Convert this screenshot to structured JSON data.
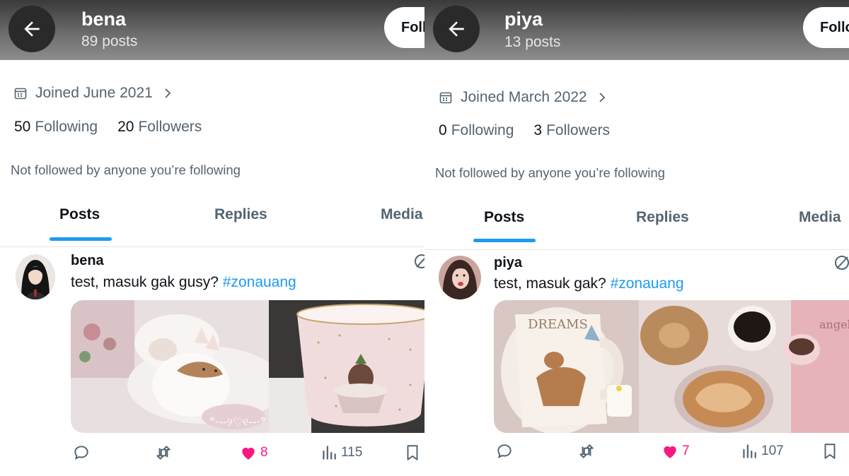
{
  "panels": [
    {
      "header": {
        "name": "bena",
        "posts": "89 posts",
        "follow_label": "Foll"
      },
      "joined": "Joined June 2021",
      "stats": {
        "following_count": "50",
        "following_label": "Following",
        "followers_count": "20",
        "followers_label": "Followers"
      },
      "not_followed": "Not followed by anyone you’re following",
      "tabs": [
        "Posts",
        "Replies",
        "Media"
      ],
      "post": {
        "author": "bena",
        "text": "test, masuk gak gusy? ",
        "hashtag": "#zonauang",
        "likes": "8",
        "views": "115"
      }
    },
    {
      "header": {
        "name": "piya",
        "posts": "13 posts",
        "follow_label": "Follo"
      },
      "joined": "Joined March 2022",
      "stats": {
        "following_count": "0",
        "following_label": "Following",
        "followers_count": "3",
        "followers_label": "Followers"
      },
      "not_followed": "Not followed by anyone you’re following",
      "tabs": [
        "Posts",
        "Replies",
        "Media"
      ],
      "post": {
        "author": "piya",
        "text": "test, masuk gak? ",
        "hashtag": "#zonauang",
        "likes": "7",
        "views": "107"
      }
    }
  ],
  "colors": {
    "accent": "#1d9bf0",
    "like": "#f91880",
    "muted": "#536471",
    "text": "#0f1419"
  },
  "icons": [
    "back-arrow-icon",
    "calendar-icon",
    "chevron-right-icon",
    "grok-icon",
    "reply-icon",
    "repost-icon",
    "heart-icon",
    "views-icon",
    "bookmark-icon"
  ]
}
